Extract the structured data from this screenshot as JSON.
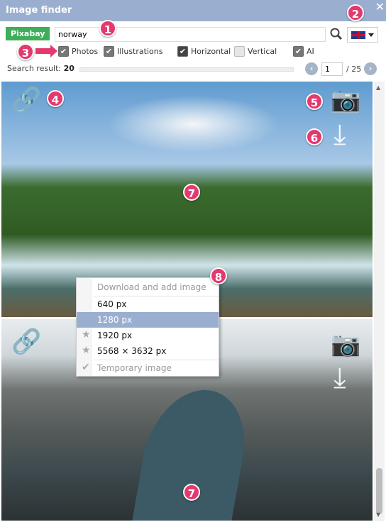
{
  "window": {
    "title": "Image finder",
    "close": "✕"
  },
  "search": {
    "source": "Pixabay",
    "query": "norway",
    "language": "en-GB"
  },
  "filters": [
    {
      "label": "Photos",
      "checked": true
    },
    {
      "label": "Illustrations",
      "checked": true
    },
    {
      "label": "Horizontal",
      "checked": true
    },
    {
      "label": "Vertical",
      "checked": false
    },
    {
      "label": "AI",
      "checked": true
    }
  ],
  "results": {
    "label": "Search result:",
    "count": "20",
    "page": "1",
    "total": "/ 25",
    "prev": "‹",
    "next": "›"
  },
  "icons": {
    "link": "🔗",
    "camera": "📷",
    "download": "⤓"
  },
  "menu": {
    "header": "Download and add image",
    "items": [
      "640 px",
      "1280 px",
      "1920 px",
      "5568 × 3632 px"
    ],
    "footer": "Temporary image",
    "selected": "1280 px"
  },
  "badges": [
    "1",
    "2",
    "3",
    "4",
    "5",
    "6",
    "7",
    "8",
    "7"
  ],
  "colors": {
    "titlebar": "#9aafd0",
    "badge": "#e23a6e",
    "source": "#3fae5a"
  }
}
